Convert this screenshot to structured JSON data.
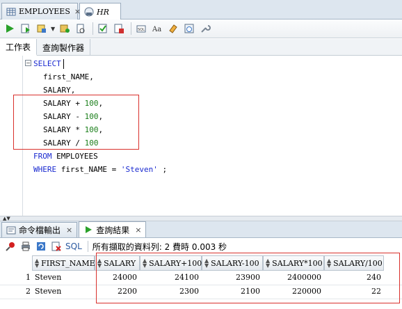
{
  "doc_tabs": [
    {
      "label": "EMPLOYEES",
      "italic": false
    },
    {
      "label": "HR",
      "italic": true
    }
  ],
  "sub_tabs": [
    "工作表",
    "查詢製作器"
  ],
  "editor": {
    "lines": [
      {
        "kind": "kw",
        "text": "SELECT"
      },
      {
        "kind": "plain",
        "text": "first_NAME,"
      },
      {
        "kind": "plain",
        "text": "SALARY,"
      },
      {
        "kind": "expr",
        "col": "SALARY",
        "op": "+",
        "num": "100",
        "tail": ","
      },
      {
        "kind": "expr",
        "col": "SALARY",
        "op": "-",
        "num": "100",
        "tail": ","
      },
      {
        "kind": "expr",
        "col": "SALARY",
        "op": "*",
        "num": "100",
        "tail": ","
      },
      {
        "kind": "expr",
        "col": "SALARY",
        "op": "/",
        "num": "100",
        "tail": ""
      },
      {
        "kind": "from",
        "kw": "FROM",
        "rest": "EMPLOYEES"
      },
      {
        "kind": "where",
        "kw": "WHERE",
        "rest": "first_NAME = ",
        "str": "'Steven'",
        "tail": " ;"
      }
    ]
  },
  "bottom_tabs": [
    {
      "label": "命令檔輸出"
    },
    {
      "label": "查詢結果"
    }
  ],
  "result_toolbar": {
    "sql_label": "SQL",
    "status": "所有擷取的資料列: 2 費時 0.003 秒"
  },
  "grid": {
    "columns": [
      "FIRST_NAME",
      "SALARY",
      "SALARY+100",
      "SALARY-100",
      "SALARY*100",
      "SALARY/100"
    ],
    "rows": [
      {
        "num": "1",
        "cells": [
          "Steven",
          "24000",
          "24100",
          "23900",
          "2400000",
          "240"
        ]
      },
      {
        "num": "2",
        "cells": [
          "Steven",
          "2200",
          "2300",
          "2100",
          "220000",
          "22"
        ]
      }
    ]
  },
  "colors": {
    "highlight": "#d9302c",
    "keyword": "#1a2ad0",
    "number": "#1a7f1a"
  }
}
